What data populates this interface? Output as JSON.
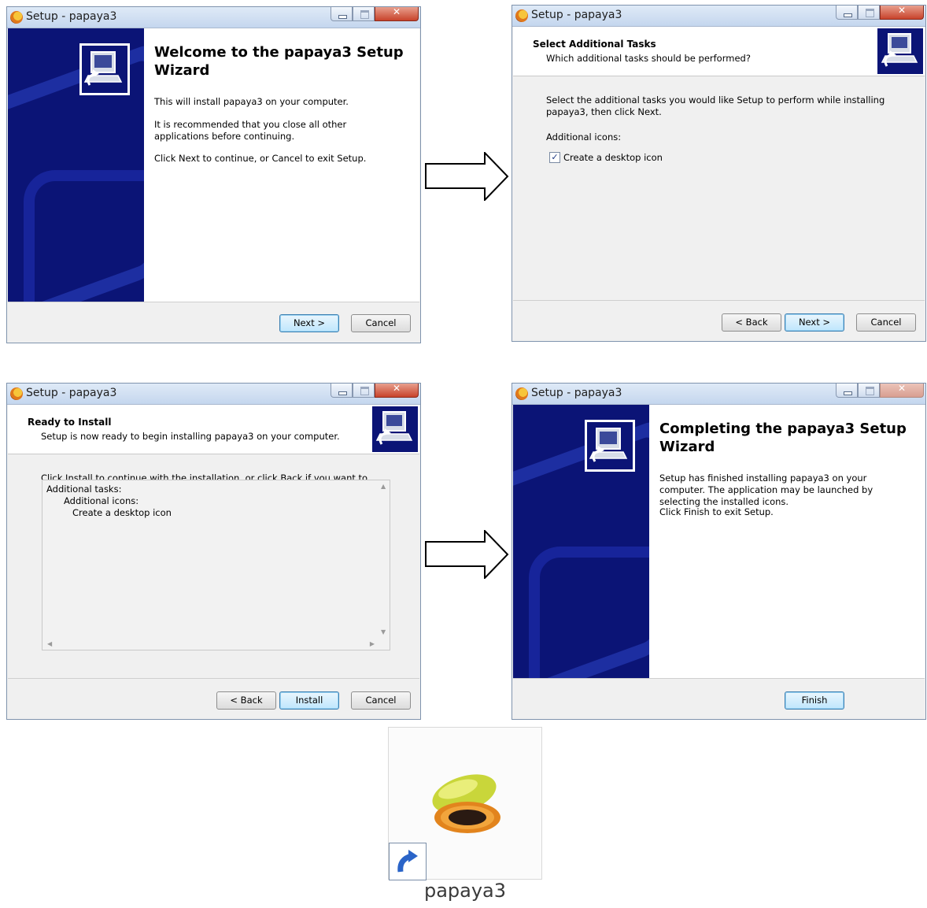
{
  "window_title": "Setup - papaya3",
  "welcome": {
    "title": "Welcome to the papaya3 Setup Wizard",
    "p1": "This will install papaya3 on your computer.",
    "p2": "It is recommended that you close all other applications before continuing.",
    "p3": "Click Next to continue, or Cancel to exit Setup.",
    "next": "Next >",
    "cancel": "Cancel"
  },
  "tasks": {
    "header_title": "Select Additional Tasks",
    "header_sub": "Which additional tasks should be performed?",
    "intro": "Select the additional tasks you would like Setup to perform while installing papaya3, then click Next.",
    "group_label": "Additional icons:",
    "checkbox_label": "Create a desktop icon",
    "checked": true,
    "back": "< Back",
    "next": "Next >",
    "cancel": "Cancel"
  },
  "ready": {
    "header_title": "Ready to Install",
    "header_sub": "Setup is now ready to begin installing papaya3 on your computer.",
    "intro": "Click Install to continue with the installation, or click Back if you want to review or change any settings.",
    "memo": [
      "Additional tasks:",
      "Additional icons:",
      "Create a desktop icon"
    ],
    "back": "< Back",
    "install": "Install",
    "cancel": "Cancel"
  },
  "finish": {
    "title": "Completing the papaya3 Setup Wizard",
    "p1": "Setup has finished installing papaya3 on your computer. The application may be launched by selecting the installed icons.",
    "p2": "Click Finish to exit Setup.",
    "finish": "Finish"
  },
  "shortcut": {
    "label": "papaya3"
  }
}
